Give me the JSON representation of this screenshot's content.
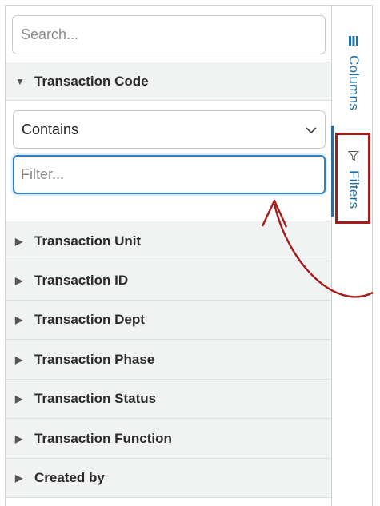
{
  "search": {
    "placeholder": "Search..."
  },
  "expanded_column": {
    "label": "Transaction Code",
    "operator": "Contains",
    "filter_placeholder": "Filter..."
  },
  "columns": [
    {
      "label": "Transaction Unit"
    },
    {
      "label": "Transaction ID"
    },
    {
      "label": "Transaction Dept"
    },
    {
      "label": "Transaction Phase"
    },
    {
      "label": "Transaction Status"
    },
    {
      "label": "Transaction Function"
    },
    {
      "label": "Created by"
    }
  ],
  "side_tabs": {
    "columns_label": "Columns",
    "filters_label": "Filters"
  },
  "colors": {
    "accent": "#1f6fa8",
    "annotation": "#a51c1c"
  }
}
